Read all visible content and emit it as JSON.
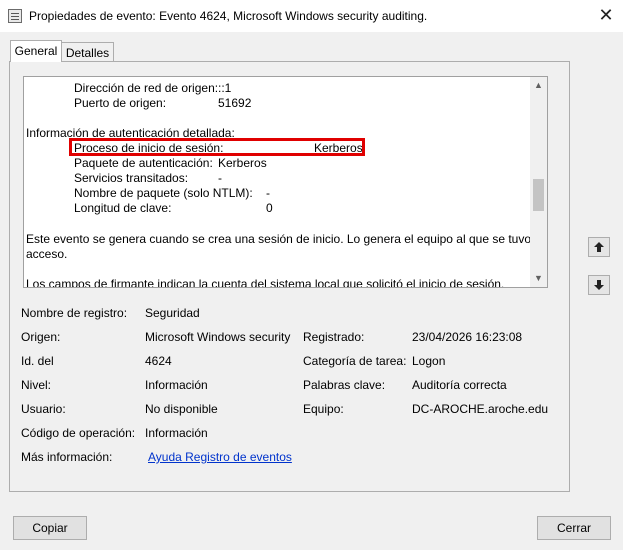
{
  "window": {
    "title": "Propiedades de evento: Evento 4624, Microsoft Windows security auditing.",
    "close_glyph": "✕"
  },
  "tabs": {
    "general": "General",
    "detalles": "Detalles"
  },
  "description": {
    "lines": {
      "dir_red_label": "Dirección de red de origen:",
      "dir_red_value": "::1",
      "puerto_label": "Puerto de origen:",
      "puerto_value": "51692",
      "auth_header": "Información de autenticación detallada:",
      "proceso_label": "Proceso de inicio de sesión:",
      "proceso_value": "Kerberos",
      "paquete_label": "Paquete de autenticación:",
      "paquete_value": "Kerberos",
      "servicios_label": "Servicios transitados:",
      "servicios_value": "-",
      "nombre_paquete_label": "Nombre de paquete (solo NTLM):",
      "nombre_paquete_value": "-",
      "longitud_label": "Longitud de clave:",
      "longitud_value": "0",
      "para1_a": "Este evento se genera cuando se crea una sesión de inicio. Lo genera el equipo al que se tuvo",
      "para1_b": "acceso.",
      "para2": "Los campos de firmante indican la cuenta del sistema local que solicitó el inicio de sesión."
    }
  },
  "fields": {
    "nombre_registro_label": "Nombre de registro:",
    "nombre_registro_value": "Seguridad",
    "origen_label": "Origen:",
    "origen_value": "Microsoft Windows security",
    "registrado_label": "Registrado:",
    "registrado_value": "23/04/2026 16:23:08",
    "id_label": "Id. del",
    "id_value": "4624",
    "categoria_label": "Categoría de tarea:",
    "categoria_value": "Logon",
    "nivel_label": "Nivel:",
    "nivel_value": "Información",
    "palabras_label": "Palabras clave:",
    "palabras_value": "Auditoría correcta",
    "usuario_label": "Usuario:",
    "usuario_value": "No disponible",
    "equipo_label": "Equipo:",
    "equipo_value": "DC-AROCHE.aroche.edu",
    "codigo_label": "Código de operación:",
    "codigo_value": "Información",
    "mas_info_label": "Más información:",
    "mas_info_link": "Ayuda Registro de eventos"
  },
  "buttons": {
    "copiar": "Copiar",
    "cerrar": "Cerrar"
  },
  "scrollbar": {
    "up_glyph": "▲",
    "down_glyph": "▼"
  },
  "colors": {
    "highlight": "#e00000",
    "link": "#0033cc"
  }
}
